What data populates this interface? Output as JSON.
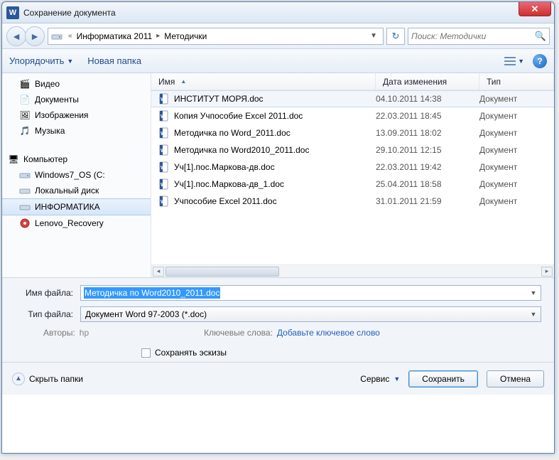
{
  "window": {
    "title": "Сохранение документа"
  },
  "breadcrumb": {
    "items": [
      "Информатика 2011",
      "Методички"
    ]
  },
  "search": {
    "placeholder": "Поиск: Методички"
  },
  "toolbar": {
    "organize": "Упорядочить",
    "new_folder": "Новая папка"
  },
  "sidebar": {
    "lib": [
      {
        "label": "Видео"
      },
      {
        "label": "Документы"
      },
      {
        "label": "Изображения"
      },
      {
        "label": "Музыка"
      }
    ],
    "computer_label": "Компьютер",
    "drives": [
      {
        "label": "Windows7_OS (C:"
      },
      {
        "label": "Локальный диск"
      },
      {
        "label": "ИНФОРМАТИКА",
        "selected": true
      },
      {
        "label": "Lenovo_Recovery"
      }
    ]
  },
  "columns": {
    "name": "Имя",
    "date": "Дата изменения",
    "type": "Тип"
  },
  "files": [
    {
      "name": "ИНСТИТУТ МОРЯ.doc",
      "date": "04.10.2011 14:38",
      "type": "Документ",
      "selected": true
    },
    {
      "name": "Копия Учпособие Excel 2011.doc",
      "date": "22.03.2011 18:45",
      "type": "Документ"
    },
    {
      "name": "Методичка по Word_2011.doc",
      "date": "13.09.2011 18:02",
      "type": "Документ"
    },
    {
      "name": "Методичка по Word2010_2011.doc",
      "date": "29.10.2011 12:15",
      "type": "Документ"
    },
    {
      "name": "Уч[1].пос.Маркова-дв.doc",
      "date": "22.03.2011 19:42",
      "type": "Документ"
    },
    {
      "name": "Уч[1].пос.Маркова-дв_1.doc",
      "date": "25.04.2011 18:58",
      "type": "Документ"
    },
    {
      "name": "Учпособие Excel 2011.doc",
      "date": "31.01.2011 21:59",
      "type": "Документ"
    }
  ],
  "form": {
    "filename_label": "Имя файла:",
    "filename_value": "Методичка по Word2010_2011.doc",
    "filetype_label": "Тип файла:",
    "filetype_value": "Документ Word 97-2003 (*.doc)",
    "authors_label": "Авторы:",
    "authors_value": "hp",
    "keywords_label": "Ключевые слова:",
    "keywords_placeholder": "Добавьте ключевое слово",
    "save_thumbnails": "Сохранять эскизы"
  },
  "footer": {
    "hide_folders": "Скрыть папки",
    "tools": "Сервис",
    "save": "Сохранить",
    "cancel": "Отмена"
  }
}
